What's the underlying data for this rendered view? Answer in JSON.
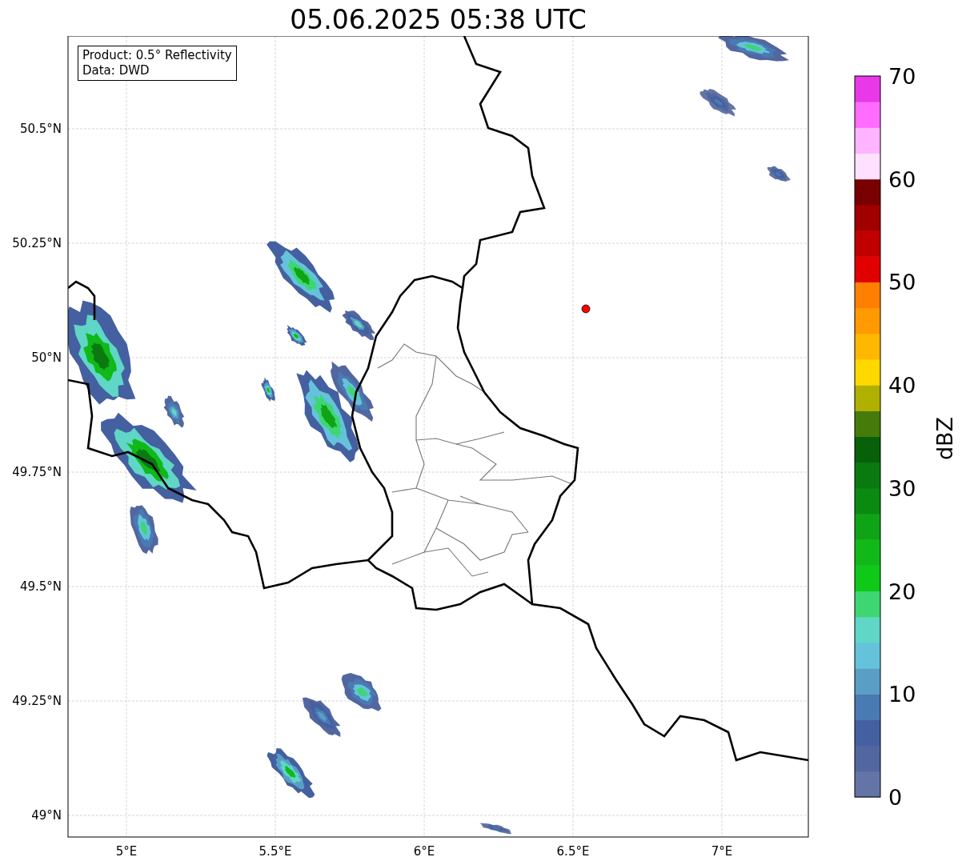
{
  "title": "05.06.2025 05:38 UTC",
  "info_box": {
    "lines": [
      "Product: 0.5° Reflectivity",
      "Data: DWD"
    ]
  },
  "map": {
    "y_ticks": [
      "50.5°N",
      "50.25°N",
      "50°N",
      "49.75°N",
      "49.5°N",
      "49.25°N",
      "49°N"
    ],
    "x_ticks": [
      "5°E",
      "5.5°E",
      "6°E",
      "6.5°E",
      "7°E"
    ]
  },
  "colorbar": {
    "label": "dBZ",
    "ticks": [
      "70",
      "60",
      "50",
      "40",
      "30",
      "20",
      "10",
      "0"
    ],
    "bins": [
      {
        "color": "#6474a6"
      },
      {
        "color": "#52679f"
      },
      {
        "color": "#4460a0"
      },
      {
        "color": "#4a7ab2"
      },
      {
        "color": "#5a9ec6"
      },
      {
        "color": "#64c3db"
      },
      {
        "color": "#5fd6c6"
      },
      {
        "color": "#3ed672"
      },
      {
        "color": "#10c818"
      },
      {
        "color": "#10b818"
      },
      {
        "color": "#0fa316"
      },
      {
        "color": "#0b8a12"
      },
      {
        "color": "#0a7a10"
      },
      {
        "color": "#08600a"
      },
      {
        "color": "#467a0a"
      },
      {
        "color": "#b0b000"
      },
      {
        "color": "#ffd800"
      },
      {
        "color": "#ffb800"
      },
      {
        "color": "#ff9a00"
      },
      {
        "color": "#ff8000"
      },
      {
        "color": "#e00000"
      },
      {
        "color": "#c00000"
      },
      {
        "color": "#a00000"
      },
      {
        "color": "#780000"
      },
      {
        "color": "#ffe0ff"
      },
      {
        "color": "#ffb4ff"
      },
      {
        "color": "#ff6cff"
      },
      {
        "color": "#e838e8"
      }
    ]
  }
}
